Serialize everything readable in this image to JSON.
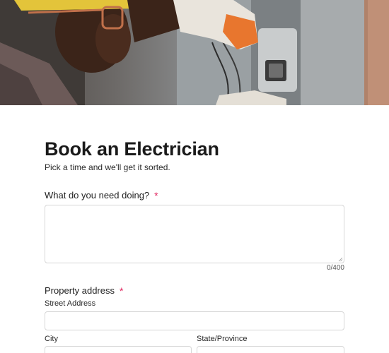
{
  "hero": {
    "image": "electrician-working-on-panel-photo"
  },
  "form": {
    "title": "Book an Electrician",
    "subtitle": "Pick a time and we'll get it sorted.",
    "job_question": {
      "label": "What do you need doing?",
      "required_mark": "*",
      "value": "",
      "char_count": "0/400"
    },
    "address": {
      "label": "Property address",
      "required_mark": "*",
      "street_label": "Street Address",
      "street_value": "",
      "city_label": "City",
      "city_value": "",
      "state_label": "State/Province",
      "state_value": ""
    }
  },
  "colors": {
    "required": "#e0245e",
    "input_border": "#d6d6d6",
    "text": "#1f1f1f"
  }
}
